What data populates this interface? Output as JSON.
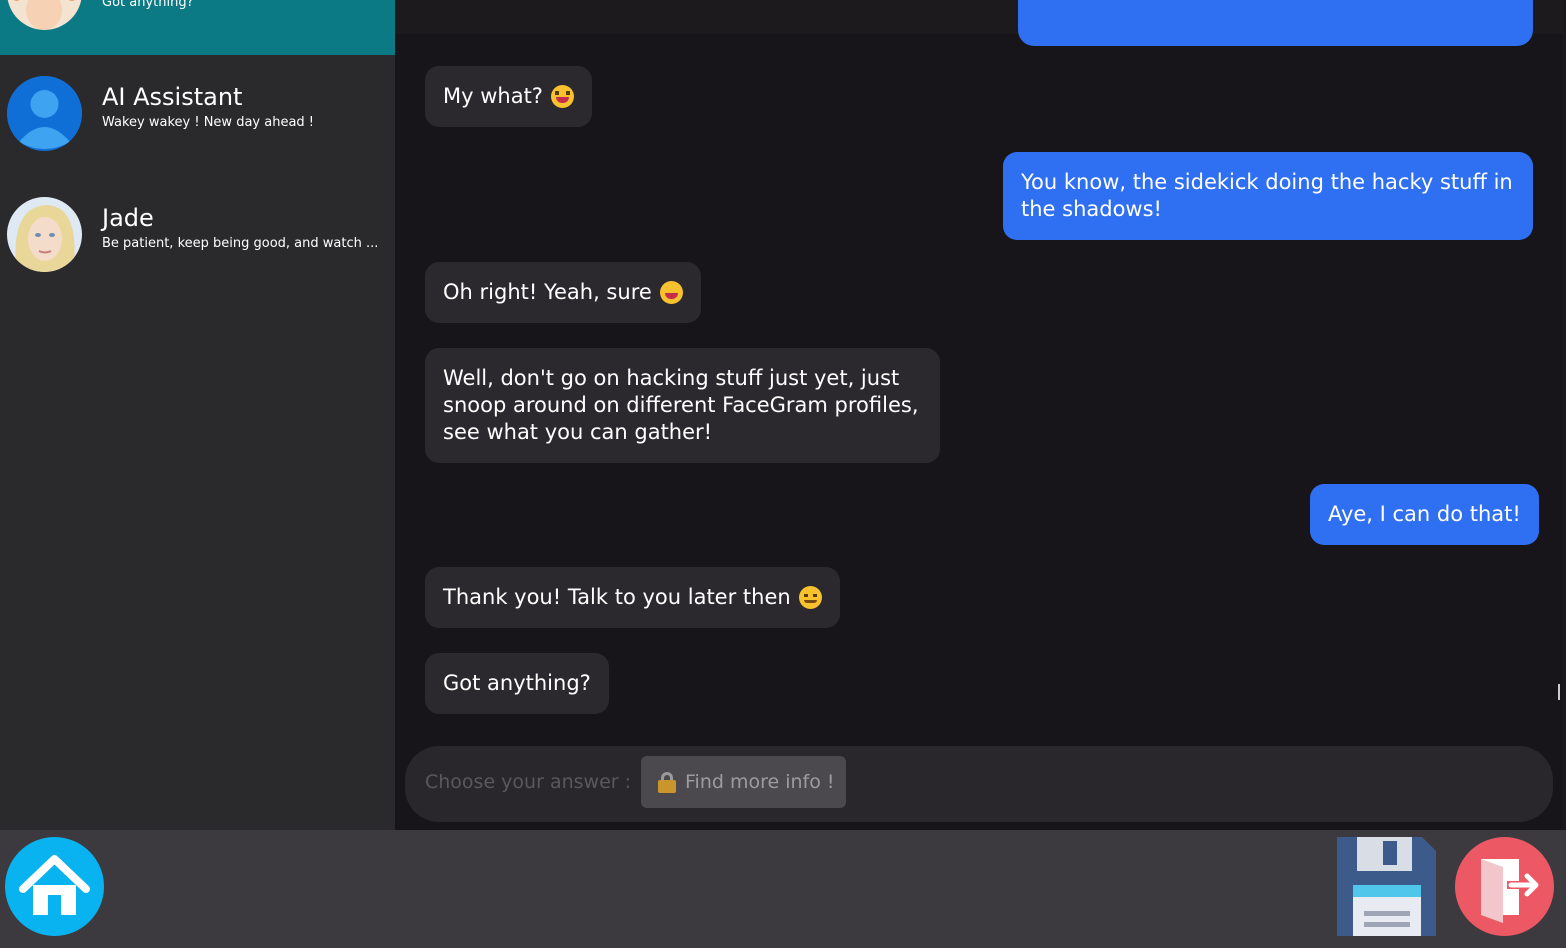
{
  "sidebar": {
    "contacts": [
      {
        "name": "",
        "preview": "Got anything?",
        "active": true
      },
      {
        "name": "AI Assistant",
        "preview": "Wakey wakey ! New day ahead !"
      },
      {
        "name": "Jade",
        "preview": "Be patient, keep being good, and watch ..."
      }
    ]
  },
  "chat": {
    "messages": [
      {
        "from": "them",
        "text": "My what?",
        "emoji": "laughing-emoji"
      },
      {
        "from": "me",
        "text": "You know, the sidekick doing the hacky stuff in the shadows!"
      },
      {
        "from": "them",
        "text": "Oh right! Yeah, sure",
        "emoji": "grinning-emoji"
      },
      {
        "from": "them",
        "text": "Well, don't go on hacking stuff just yet, just snoop around on different FaceGram profiles, see what you can gather!"
      },
      {
        "from": "me",
        "text": "Aye, I can do that!"
      },
      {
        "from": "them",
        "text": "Thank you! Talk to you later then",
        "emoji": "smiling-emoji"
      },
      {
        "from": "them",
        "text": "Got anything?"
      }
    ]
  },
  "answer_bar": {
    "label": "Choose your answer :",
    "option_label": "Find more info !",
    "option_icon": "lock-icon"
  },
  "bottom_bar": {
    "home_icon": "home-icon",
    "save_icon": "floppy-disk-icon",
    "exit_icon": "exit-door-icon"
  },
  "colors": {
    "active_contact": "#0b7a85",
    "outgoing_bubble": "#2f6ff1",
    "incoming_bubble": "#2b292d",
    "home_button": "#08b3ef",
    "exit_button": "#ec5864"
  }
}
